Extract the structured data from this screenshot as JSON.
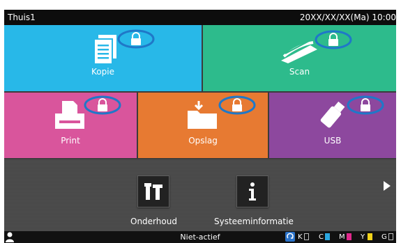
{
  "header": {
    "title": "Thuis1",
    "datetime": "20XX/XX/XX(Ma) 10:00"
  },
  "tiles": [
    {
      "label": "Kopie",
      "color": "#28b8e8",
      "icon": "document-icon"
    },
    {
      "label": "Scan",
      "color": "#2dbb8c",
      "icon": "scanner-icon"
    },
    {
      "label": "Print",
      "color": "#d9559c",
      "icon": "printer-icon"
    },
    {
      "label": "Opslag",
      "color": "#e77a32",
      "icon": "folder-icon"
    },
    {
      "label": "USB",
      "color": "#8d489e",
      "icon": "usb-icon"
    }
  ],
  "tools": [
    {
      "label": "Onderhoud",
      "icon": "tools-icon"
    },
    {
      "label": "Systeeminformatie",
      "icon": "info-icon"
    }
  ],
  "status": {
    "text": "Niet-actief",
    "inks": [
      {
        "letter": "K",
        "color": "#ffffff",
        "level": "empty"
      },
      {
        "letter": "C",
        "color": "#2aa7e0",
        "level": "full"
      },
      {
        "letter": "M",
        "color": "#e0278b",
        "level": "full"
      },
      {
        "letter": "Y",
        "color": "#f1d21a",
        "level": "full"
      },
      {
        "letter": "G",
        "color": "#ffffff",
        "level": "empty"
      }
    ]
  },
  "lock_ring_color": "#1f78c8"
}
